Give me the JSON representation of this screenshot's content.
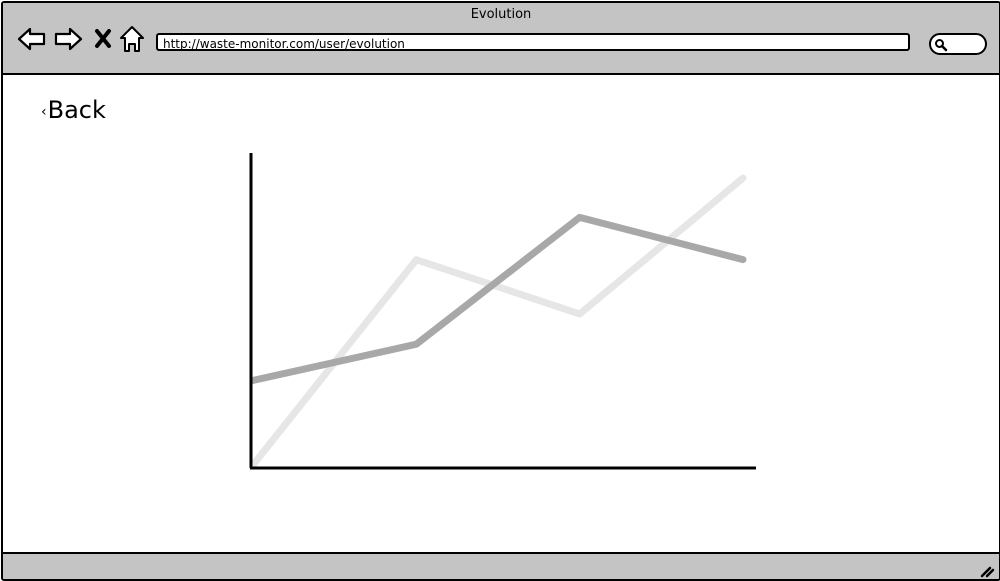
{
  "window": {
    "title": "Evolution"
  },
  "browser": {
    "url": "http://waste-monitor.com/user/evolution",
    "icons": [
      "back-arrow-icon",
      "forward-arrow-icon",
      "close-icon",
      "home-icon",
      "search-icon"
    ]
  },
  "page": {
    "back_arrow": "‹",
    "back_label": "Back"
  },
  "chart_data": {
    "type": "line",
    "x": [
      0,
      1,
      2,
      3
    ],
    "ylim": [
      0,
      100
    ],
    "xlim": [
      0,
      3
    ],
    "grid": false,
    "series": [
      {
        "values": [
          0,
          68,
          50,
          95
        ],
        "color": "#e6e6e6"
      },
      {
        "values": [
          28,
          40,
          82,
          68
        ],
        "color": "#a8a8a8"
      }
    ],
    "axis_color": "#000000"
  },
  "colors": {
    "chrome": "#c4c4c4",
    "background": "#ffffff",
    "border": "#000000"
  }
}
